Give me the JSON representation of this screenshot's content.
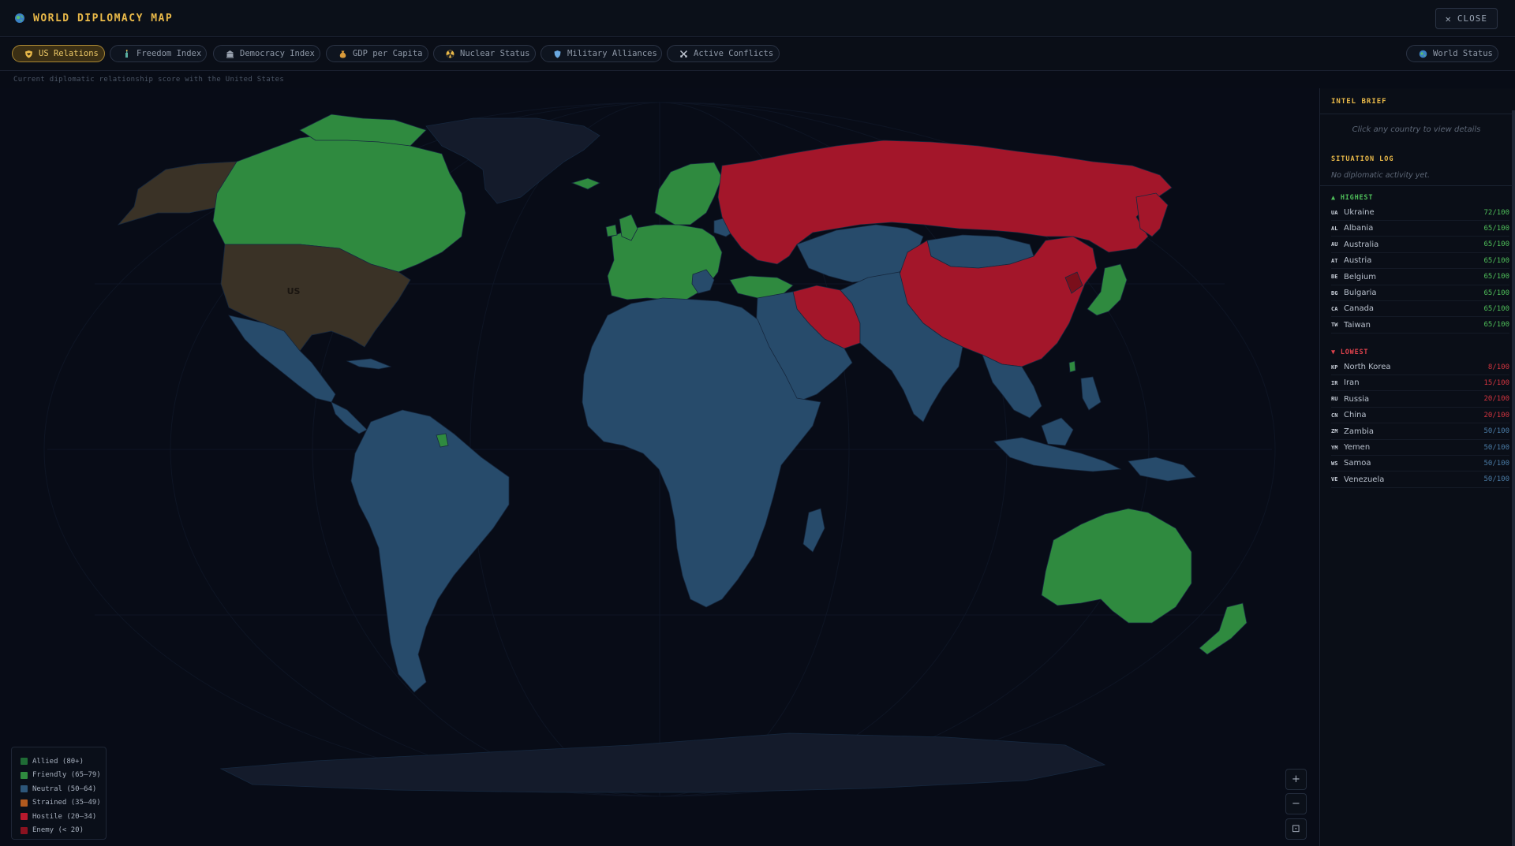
{
  "header": {
    "title": "WORLD DIPLOMACY MAP",
    "close_label": "CLOSE"
  },
  "tabs": [
    {
      "label": "US Relations",
      "icon": "shield-heart-icon",
      "active": true
    },
    {
      "label": "Freedom Index",
      "icon": "liberty-statue-icon",
      "active": false
    },
    {
      "label": "Democracy Index",
      "icon": "capitol-building-icon",
      "active": false
    },
    {
      "label": "GDP per Capita",
      "icon": "money-bag-icon",
      "active": false
    },
    {
      "label": "Nuclear Status",
      "icon": "radiation-icon",
      "active": false
    },
    {
      "label": "Military Alliances",
      "icon": "shield-icon",
      "active": false
    },
    {
      "label": "Active Conflicts",
      "icon": "crossed-swords-icon",
      "active": false
    }
  ],
  "world_status_label": "World Status",
  "subtitle": "Current diplomatic relationship score with the United States",
  "map": {
    "highlight_label": "US",
    "colors": {
      "allied": "#1f6b35",
      "friendly": "#2f8a3f",
      "neutral": "#274b6b",
      "strained": "#a34e1d",
      "hostile": "#a3162a",
      "enemy": "#7b0f1b",
      "self": "#3a3226",
      "no_data": "#141b2b",
      "ocean": "#080c17",
      "border": "#14243a"
    }
  },
  "legend": [
    {
      "label": "Allied (80+)",
      "color": "#1f6b35"
    },
    {
      "label": "Friendly (65–79)",
      "color": "#2f8a3f"
    },
    {
      "label": "Neutral (50–64)",
      "color": "#2d5679"
    },
    {
      "label": "Strained (35–49)",
      "color": "#b15a1f"
    },
    {
      "label": "Hostile (20–34)",
      "color": "#b8192d"
    },
    {
      "label": "Enemy (< 20)",
      "color": "#8a1220"
    }
  ],
  "zoom": {
    "in": "+",
    "out": "−",
    "reset": "⊡"
  },
  "panel": {
    "title": "INTEL BRIEF",
    "hint": "Click any country to view details",
    "log_title": "SITUATION LOG",
    "log_empty": "No diplomatic activity yet.",
    "highest_label": "▲ HIGHEST",
    "lowest_label": "▼ LOWEST",
    "highest": [
      {
        "code": "UA",
        "name": "Ukraine",
        "score": "72/100"
      },
      {
        "code": "AL",
        "name": "Albania",
        "score": "65/100"
      },
      {
        "code": "AU",
        "name": "Australia",
        "score": "65/100"
      },
      {
        "code": "AT",
        "name": "Austria",
        "score": "65/100"
      },
      {
        "code": "BE",
        "name": "Belgium",
        "score": "65/100"
      },
      {
        "code": "BG",
        "name": "Bulgaria",
        "score": "65/100"
      },
      {
        "code": "CA",
        "name": "Canada",
        "score": "65/100"
      },
      {
        "code": "TW",
        "name": "Taiwan",
        "score": "65/100"
      }
    ],
    "lowest": [
      {
        "code": "KP",
        "name": "North Korea",
        "score": "8/100",
        "color": "#d3343f"
      },
      {
        "code": "IR",
        "name": "Iran",
        "score": "15/100",
        "color": "#d3343f"
      },
      {
        "code": "RU",
        "name": "Russia",
        "score": "20/100",
        "color": "#d3343f"
      },
      {
        "code": "CN",
        "name": "China",
        "score": "20/100",
        "color": "#d3343f"
      },
      {
        "code": "ZM",
        "name": "Zambia",
        "score": "50/100",
        "color": "#4a7ba5"
      },
      {
        "code": "YM",
        "name": "Yemen",
        "score": "50/100",
        "color": "#4a7ba5"
      },
      {
        "code": "WS",
        "name": "Samoa",
        "score": "50/100",
        "color": "#4a7ba5"
      },
      {
        "code": "VE",
        "name": "Venezuela",
        "score": "50/100",
        "color": "#4a7ba5"
      }
    ]
  }
}
